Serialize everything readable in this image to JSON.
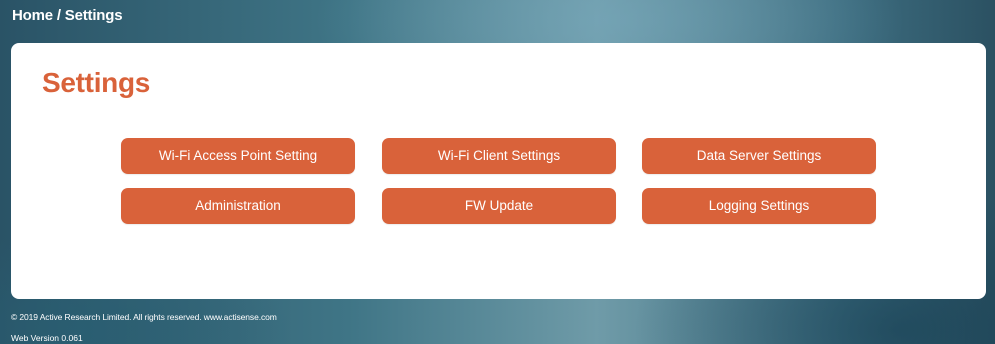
{
  "breadcrumb": "Home / Settings",
  "page": {
    "title": "Settings"
  },
  "buttons": {
    "wifi_ap": "Wi-Fi Access Point Setting",
    "wifi_client": "Wi-Fi Client Settings",
    "data_server": "Data Server Settings",
    "administration": "Administration",
    "fw_update": "FW Update",
    "logging": "Logging Settings"
  },
  "footer": {
    "copyright": "© 2019 Active Research Limited. All rights reserved.  www.actisense.com",
    "version": "Web Version 0.061"
  },
  "colors": {
    "accent": "#d9623a",
    "card": "#ffffff"
  }
}
